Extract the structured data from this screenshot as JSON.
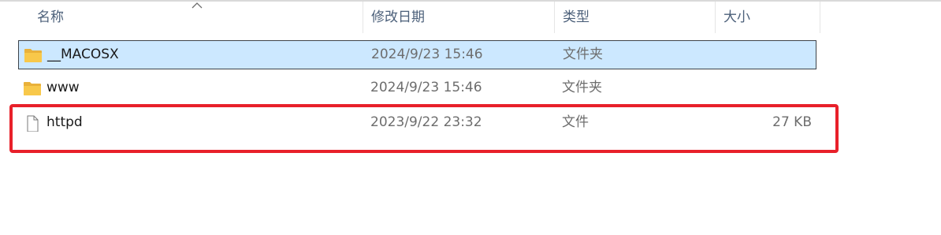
{
  "columns": {
    "name": "名称",
    "date": "修改日期",
    "type": "类型",
    "size": "大小"
  },
  "sort": {
    "column": "name",
    "direction": "ascending",
    "indicator_icon": "sort-up-chevron-icon"
  },
  "files": [
    {
      "name": "__MACOSX",
      "modified": "2024/9/23 15:46",
      "type": "文件夹",
      "size": "",
      "icon": "folder-icon",
      "selected": true
    },
    {
      "name": "www",
      "modified": "2024/9/23 15:46",
      "type": "文件夹",
      "size": "",
      "icon": "folder-icon",
      "selected": false
    },
    {
      "name": "httpd",
      "modified": "2023/9/22 23:32",
      "type": "文件",
      "size": "27 KB",
      "icon": "file-icon",
      "selected": false,
      "highlighted": true
    }
  ],
  "colors": {
    "selection_bg": "#cce8ff",
    "selection_border": "#3d4349",
    "header_text": "#4c607a",
    "folder": "#f8c84a",
    "highlight": "#e8202a"
  }
}
